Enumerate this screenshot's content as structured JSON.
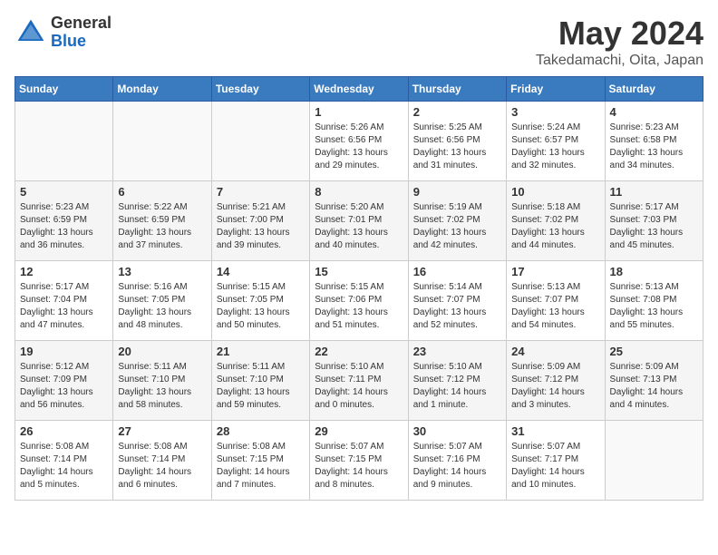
{
  "header": {
    "logo_general": "General",
    "logo_blue": "Blue",
    "month_year": "May 2024",
    "location": "Takedamachi, Oita, Japan"
  },
  "days_of_week": [
    "Sunday",
    "Monday",
    "Tuesday",
    "Wednesday",
    "Thursday",
    "Friday",
    "Saturday"
  ],
  "weeks": [
    [
      {
        "day": "",
        "info": ""
      },
      {
        "day": "",
        "info": ""
      },
      {
        "day": "",
        "info": ""
      },
      {
        "day": "1",
        "info": "Sunrise: 5:26 AM\nSunset: 6:56 PM\nDaylight: 13 hours\nand 29 minutes."
      },
      {
        "day": "2",
        "info": "Sunrise: 5:25 AM\nSunset: 6:56 PM\nDaylight: 13 hours\nand 31 minutes."
      },
      {
        "day": "3",
        "info": "Sunrise: 5:24 AM\nSunset: 6:57 PM\nDaylight: 13 hours\nand 32 minutes."
      },
      {
        "day": "4",
        "info": "Sunrise: 5:23 AM\nSunset: 6:58 PM\nDaylight: 13 hours\nand 34 minutes."
      }
    ],
    [
      {
        "day": "5",
        "info": "Sunrise: 5:23 AM\nSunset: 6:59 PM\nDaylight: 13 hours\nand 36 minutes."
      },
      {
        "day": "6",
        "info": "Sunrise: 5:22 AM\nSunset: 6:59 PM\nDaylight: 13 hours\nand 37 minutes."
      },
      {
        "day": "7",
        "info": "Sunrise: 5:21 AM\nSunset: 7:00 PM\nDaylight: 13 hours\nand 39 minutes."
      },
      {
        "day": "8",
        "info": "Sunrise: 5:20 AM\nSunset: 7:01 PM\nDaylight: 13 hours\nand 40 minutes."
      },
      {
        "day": "9",
        "info": "Sunrise: 5:19 AM\nSunset: 7:02 PM\nDaylight: 13 hours\nand 42 minutes."
      },
      {
        "day": "10",
        "info": "Sunrise: 5:18 AM\nSunset: 7:02 PM\nDaylight: 13 hours\nand 44 minutes."
      },
      {
        "day": "11",
        "info": "Sunrise: 5:17 AM\nSunset: 7:03 PM\nDaylight: 13 hours\nand 45 minutes."
      }
    ],
    [
      {
        "day": "12",
        "info": "Sunrise: 5:17 AM\nSunset: 7:04 PM\nDaylight: 13 hours\nand 47 minutes."
      },
      {
        "day": "13",
        "info": "Sunrise: 5:16 AM\nSunset: 7:05 PM\nDaylight: 13 hours\nand 48 minutes."
      },
      {
        "day": "14",
        "info": "Sunrise: 5:15 AM\nSunset: 7:05 PM\nDaylight: 13 hours\nand 50 minutes."
      },
      {
        "day": "15",
        "info": "Sunrise: 5:15 AM\nSunset: 7:06 PM\nDaylight: 13 hours\nand 51 minutes."
      },
      {
        "day": "16",
        "info": "Sunrise: 5:14 AM\nSunset: 7:07 PM\nDaylight: 13 hours\nand 52 minutes."
      },
      {
        "day": "17",
        "info": "Sunrise: 5:13 AM\nSunset: 7:07 PM\nDaylight: 13 hours\nand 54 minutes."
      },
      {
        "day": "18",
        "info": "Sunrise: 5:13 AM\nSunset: 7:08 PM\nDaylight: 13 hours\nand 55 minutes."
      }
    ],
    [
      {
        "day": "19",
        "info": "Sunrise: 5:12 AM\nSunset: 7:09 PM\nDaylight: 13 hours\nand 56 minutes."
      },
      {
        "day": "20",
        "info": "Sunrise: 5:11 AM\nSunset: 7:10 PM\nDaylight: 13 hours\nand 58 minutes."
      },
      {
        "day": "21",
        "info": "Sunrise: 5:11 AM\nSunset: 7:10 PM\nDaylight: 13 hours\nand 59 minutes."
      },
      {
        "day": "22",
        "info": "Sunrise: 5:10 AM\nSunset: 7:11 PM\nDaylight: 14 hours\nand 0 minutes."
      },
      {
        "day": "23",
        "info": "Sunrise: 5:10 AM\nSunset: 7:12 PM\nDaylight: 14 hours\nand 1 minute."
      },
      {
        "day": "24",
        "info": "Sunrise: 5:09 AM\nSunset: 7:12 PM\nDaylight: 14 hours\nand 3 minutes."
      },
      {
        "day": "25",
        "info": "Sunrise: 5:09 AM\nSunset: 7:13 PM\nDaylight: 14 hours\nand 4 minutes."
      }
    ],
    [
      {
        "day": "26",
        "info": "Sunrise: 5:08 AM\nSunset: 7:14 PM\nDaylight: 14 hours\nand 5 minutes."
      },
      {
        "day": "27",
        "info": "Sunrise: 5:08 AM\nSunset: 7:14 PM\nDaylight: 14 hours\nand 6 minutes."
      },
      {
        "day": "28",
        "info": "Sunrise: 5:08 AM\nSunset: 7:15 PM\nDaylight: 14 hours\nand 7 minutes."
      },
      {
        "day": "29",
        "info": "Sunrise: 5:07 AM\nSunset: 7:15 PM\nDaylight: 14 hours\nand 8 minutes."
      },
      {
        "day": "30",
        "info": "Sunrise: 5:07 AM\nSunset: 7:16 PM\nDaylight: 14 hours\nand 9 minutes."
      },
      {
        "day": "31",
        "info": "Sunrise: 5:07 AM\nSunset: 7:17 PM\nDaylight: 14 hours\nand 10 minutes."
      },
      {
        "day": "",
        "info": ""
      }
    ]
  ]
}
